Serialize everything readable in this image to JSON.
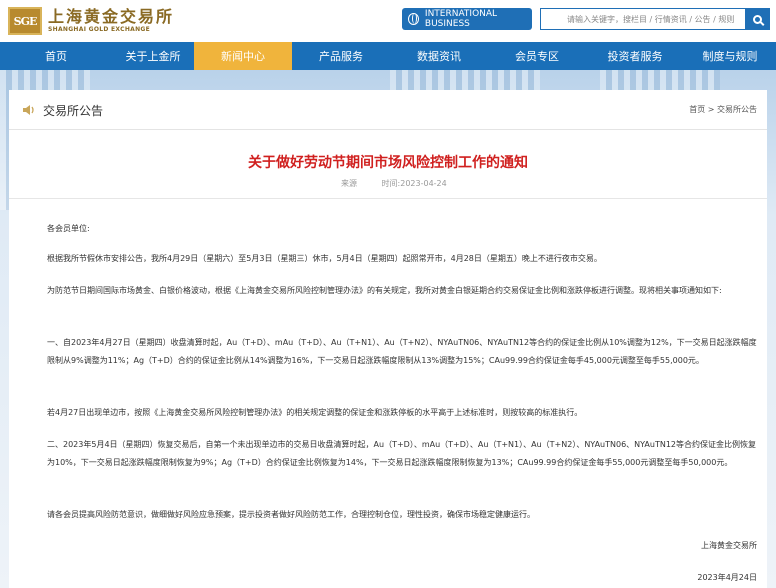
{
  "header": {
    "logo_cn": "上海黄金交易所",
    "logo_en": "SHANGHAI GOLD EXCHANGE",
    "logo_mark": "SGE",
    "intl_label": "INTERNATIONAL BUSINESS",
    "search_placeholder": "请输入关键字，搜栏目 / 行情资讯 / 公告 / 规则"
  },
  "nav": {
    "items": [
      {
        "label": "首页"
      },
      {
        "label": "关于上金所"
      },
      {
        "label": "新闻中心"
      },
      {
        "label": "产品服务"
      },
      {
        "label": "数据资讯"
      },
      {
        "label": "会员专区"
      },
      {
        "label": "投资者服务"
      },
      {
        "label": "制度与规则"
      }
    ],
    "active_index": 2
  },
  "section": {
    "title": "交易所公告",
    "breadcrumb": "首页 > 交易所公告"
  },
  "article": {
    "title": "关于做好劳动节期间市场风险控制工作的通知",
    "source_label": "来源",
    "time_label": "时间:2023-04-24",
    "greeting": "各会员单位:",
    "paragraphs": [
      "根据我所节假休市安排公告，我所4月29日（星期六）至5月3日（星期三）休市，5月4日（星期四）起照常开市，4月28日（星期五）晚上不进行夜市交易。",
      "为防范节日期间国际市场黄金、白银价格波动，根据《上海黄金交易所风险控制管理办法》的有关规定，我所对黄金白银延期合约交易保证金比例和涨跌停板进行调整。现将相关事项通知如下:",
      "一、自2023年4月27日（星期四）收盘清算时起，Au（T+D）、mAu（T+D）、Au（T+N1）、Au（T+N2）、NYAuTN06、NYAuTN12等合约的保证金比例从10%调整为12%，下一交易日起涨跌幅度限制从9%调整为11%；Ag（T+D）合约的保证金比例从14%调整为16%，下一交易日起涨跌幅度限制从13%调整为15%；CAu99.99合约保证金每手45,000元调整至每手55,000元。",
      "若4月27日出现单边市，按照《上海黄金交易所风险控制管理办法》的相关规定调整的保证金和涨跌停板的水平高于上述标准时，则按较高的标准执行。",
      "二、2023年5月4日（星期四）恢复交易后，自第一个未出现单边市的交易日收盘清算时起，Au（T+D）、mAu（T+D）、Au（T+N1）、Au（T+N2）、NYAuTN06、NYAuTN12等合约保证金比例恢复为10%，下一交易日起涨跌幅度限制恢复为9%；Ag（T+D）合约保证金比例恢复为14%，下一交易日起涨跌幅度限制恢复为13%；CAu99.99合约保证金每手55,000元调整至每手50,000元。",
      "请各会员提高风险防范意识，做细做好风险应急预案，提示投资者做好风险防范工作，合理控制仓位，理性投资，确保市场稳定健康运行。"
    ],
    "signature": "上海黄金交易所",
    "date": "2023年4月24日"
  },
  "colors": {
    "nav_bg": "#1a6fb8",
    "nav_active": "#f0b43c",
    "title_red": "#d0201f",
    "brand_gold": "#8a6a24"
  }
}
